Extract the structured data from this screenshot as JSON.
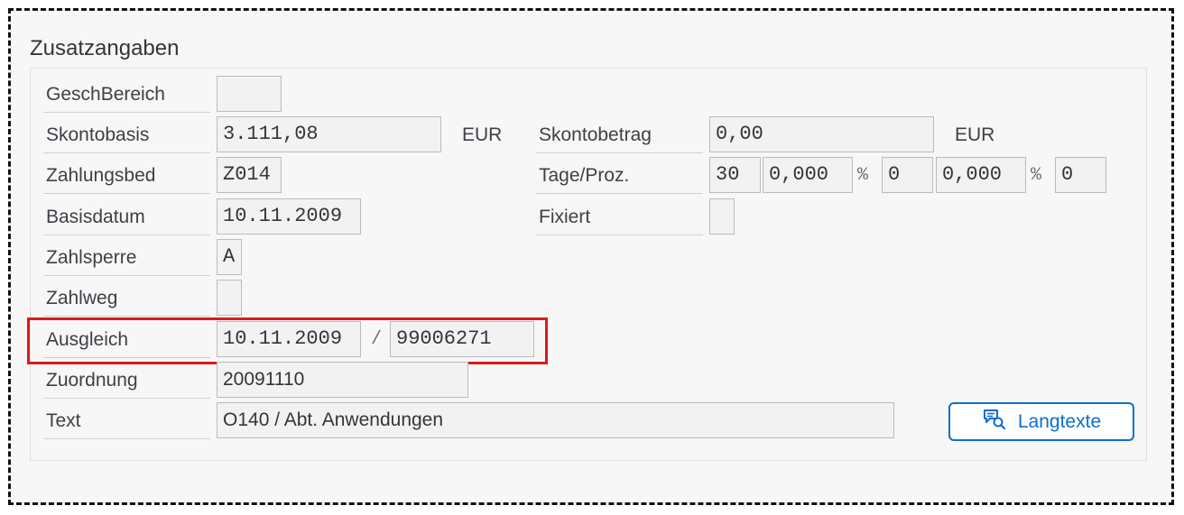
{
  "section": {
    "title": "Zusatzangaben"
  },
  "fields": {
    "geschbereich": {
      "label": "GeschBereich",
      "value": ""
    },
    "skontobasis": {
      "label": "Skontobasis",
      "value": "3.111,08",
      "currency": "EUR"
    },
    "skontobetrag": {
      "label": "Skontobetrag",
      "value": "0,00",
      "currency": "EUR"
    },
    "zahlungsbed": {
      "label": "Zahlungsbed",
      "value": "Z014"
    },
    "tage_proz": {
      "label": "Tage/Proz.",
      "days1": "30",
      "pct1": "0,000",
      "pct_sign1": "%",
      "days2": "0",
      "pct2": "0,000",
      "pct_sign2": "%",
      "days3": "0"
    },
    "basisdatum": {
      "label": "Basisdatum",
      "value": "10.11.2009"
    },
    "fixiert": {
      "label": "Fixiert",
      "value": ""
    },
    "zahlsperre": {
      "label": "Zahlsperre",
      "value": "A"
    },
    "zahlweg": {
      "label": "Zahlweg",
      "value": ""
    },
    "ausgleich": {
      "label": "Ausgleich",
      "date": "10.11.2009",
      "separator": "/",
      "doc": "99006271"
    },
    "zuordnung": {
      "label": "Zuordnung",
      "value": "20091110"
    },
    "text": {
      "label": "Text",
      "value": "O140 / Abt. Anwendungen"
    }
  },
  "buttons": {
    "langtexte": {
      "label": "Langtexte",
      "icon": "long-text-icon"
    }
  },
  "colors": {
    "highlight": "#e0191a",
    "accent": "#0a6ed1"
  }
}
